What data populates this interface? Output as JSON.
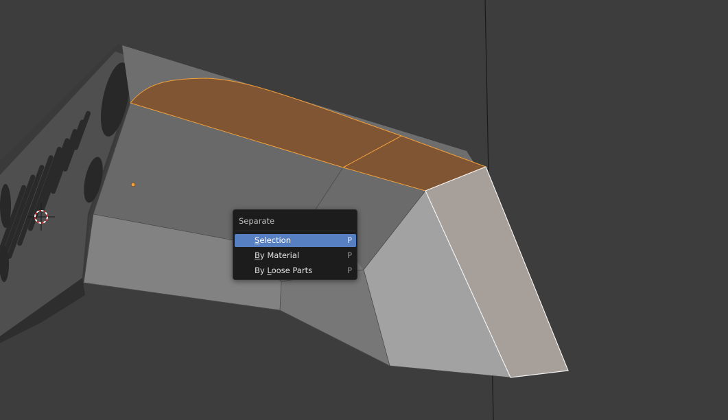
{
  "menu": {
    "title": "Separate",
    "items": [
      {
        "first": "S",
        "rest": "election",
        "shortcut": "P",
        "active": true
      },
      {
        "first": "B",
        "rest": "y Material",
        "shortcut": "P",
        "active": false
      },
      {
        "first": "",
        "rest": "",
        "shortcut": "P",
        "active": false
      }
    ],
    "loose_parts": {
      "pre": "By ",
      "first": "L",
      "rest": "oose Parts"
    }
  },
  "colors": {
    "background": "#3d3d3d",
    "selected_face": "#7f5533",
    "selected_edge": "#f0a03c",
    "highlight": "#5680c2"
  }
}
